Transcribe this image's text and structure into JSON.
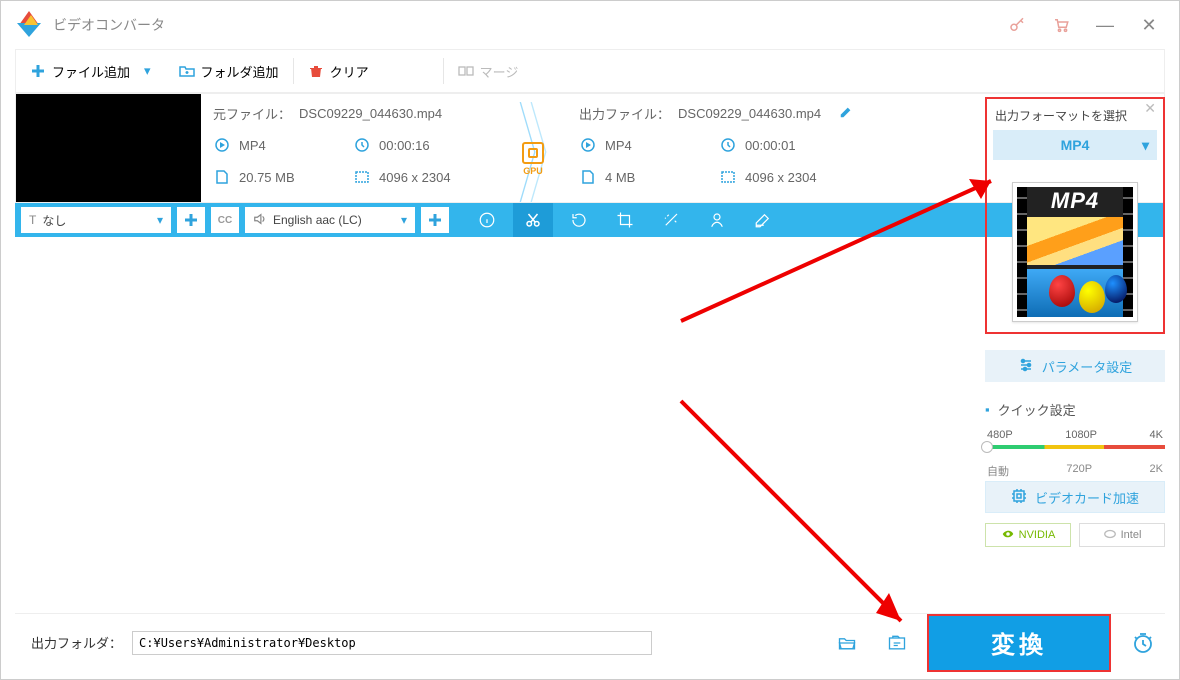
{
  "app": {
    "title": "ビデオコンバータ"
  },
  "toolbar": {
    "add_file": "ファイル追加",
    "add_folder": "フォルダ追加",
    "clear": "クリア",
    "merge": "マージ"
  },
  "file": {
    "source_label": "元ファイル：",
    "output_label": "出力ファイル：",
    "source_name": "DSC09229_044630.mp4",
    "output_name": "DSC09229_044630.mp4",
    "src": {
      "format": "MP4",
      "duration": "00:00:16",
      "size": "20.75 MB",
      "resolution": "4096 x 2304"
    },
    "out": {
      "format": "MP4",
      "duration": "00:00:01",
      "size": "4 MB",
      "resolution": "4096 x 2304"
    },
    "gpu_badge": "GPU"
  },
  "strip": {
    "subtitle_none": "なし",
    "audio_track": "English aac (LC)"
  },
  "right": {
    "format_title": "出力フォーマットを選択",
    "format_selected": "MP4",
    "format_card_label": "MP4",
    "param_btn": "パラメータ設定",
    "quick_title": "クイック設定",
    "res_top": [
      "480P",
      "1080P",
      "4K"
    ],
    "res_bottom": [
      "自動",
      "720P",
      "2K"
    ],
    "gpu_accel": "ビデオカード加速",
    "vendors": {
      "nvidia": "NVIDIA",
      "intel": "Intel"
    }
  },
  "bottom": {
    "out_folder_label": "出力フォルダ：",
    "out_folder_path": "C:¥Users¥Administrator¥Desktop",
    "convert": "変換"
  }
}
